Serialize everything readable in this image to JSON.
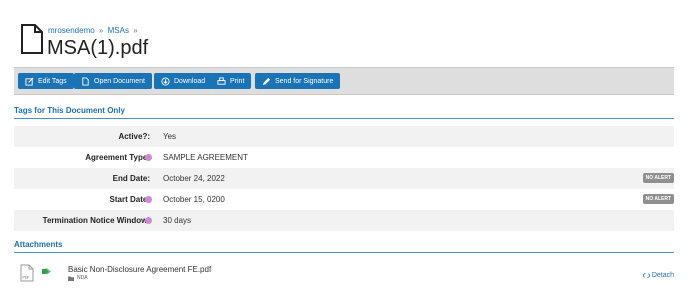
{
  "breadcrumb": [
    "mrosendemo",
    "MSAs"
  ],
  "breadcrumb_separator": "»",
  "document_title": "MSA(1).pdf",
  "toolbar": {
    "buttons": [
      {
        "label": "Edit Tags",
        "icon": "edit-icon"
      },
      {
        "label": "Open Document",
        "icon": "document-icon"
      },
      {
        "label": "Download",
        "icon": "download-icon"
      },
      {
        "label": "Print",
        "icon": "print-icon"
      },
      {
        "label": "Send for Signature",
        "icon": "pen-icon"
      }
    ]
  },
  "tags_section": {
    "title": "Tags for This Document Only",
    "rows": [
      {
        "label": "Active?:",
        "value": "Yes"
      },
      {
        "label": "Agreement Type:",
        "value": "SAMPLE AGREEMENT"
      },
      {
        "label": "End Date:",
        "value": "October 24, 2022",
        "badge": "NO ALERT"
      },
      {
        "label": "Start Date:",
        "value": "October 15, 0200",
        "badge": "NO ALERT"
      },
      {
        "label": "Termination Notice Window:",
        "value": "30 days"
      }
    ]
  },
  "attachments_section": {
    "title": "Attachments",
    "items": [
      {
        "name": "Basic Non-Disclosure Agreement FE.pdf",
        "folder": "NDA",
        "action": "Detach",
        "icon_label": "PDF"
      }
    ]
  },
  "colors": {
    "accent": "#1973b5",
    "dot": "#cf88d4",
    "badge": "#8f8f8f",
    "toolbar_bg": "#dedede"
  }
}
